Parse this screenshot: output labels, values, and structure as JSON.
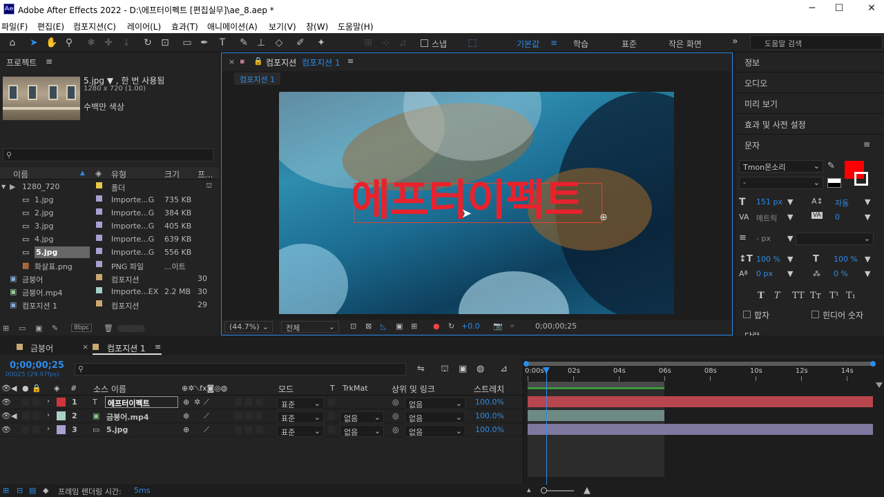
{
  "app_title": "Adobe After Effects 2022 - D:\\에프터이펙트 [편집실무]\\ae_8.aep *",
  "app_icon": "Ae",
  "window_controls": [
    "─",
    "☐",
    "✕"
  ],
  "menu": [
    "파일(F)",
    "편집(E)",
    "컴포지션(C)",
    "레이어(L)",
    "효과(T)",
    "애니메이션(A)",
    "보기(V)",
    "창(W)",
    "도움말(H)"
  ],
  "toolbar": {
    "snap_label": "스냅",
    "workspaces": [
      "기본값",
      "학습",
      "표준",
      "작은 화면"
    ],
    "active_workspace": "기본값",
    "more": "»",
    "search_placeholder": "도움말 검색"
  },
  "project": {
    "title": "프로젝트",
    "selected_name": "5.jpg ▼ , 한 번 사용됨",
    "selected_dims": "1280 x 720 (1.00)",
    "selected_color": "수백만 색상",
    "search_icon": "search-icon",
    "columns": [
      "이름",
      "유형",
      "크기",
      "프..."
    ],
    "items": [
      {
        "name": "1280_720",
        "type": "폴더",
        "size": "",
        "extra": "",
        "color": "#e6c94a",
        "indent": 0,
        "kind": "folder"
      },
      {
        "name": "1.jpg",
        "type": "Importe...G",
        "size": "735 KB",
        "extra": "",
        "color": "#a9a0d1",
        "indent": 1,
        "kind": "file"
      },
      {
        "name": "2.jpg",
        "type": "Importe...G",
        "size": "384 KB",
        "extra": "",
        "color": "#a9a0d1",
        "indent": 1,
        "kind": "file"
      },
      {
        "name": "3.jpg",
        "type": "Importe...G",
        "size": "405 KB",
        "extra": "",
        "color": "#a9a0d1",
        "indent": 1,
        "kind": "file"
      },
      {
        "name": "4.jpg",
        "type": "Importe...G",
        "size": "639 KB",
        "extra": "",
        "color": "#a9a0d1",
        "indent": 1,
        "kind": "file"
      },
      {
        "name": "5.jpg",
        "type": "Importe...G",
        "size": "556 KB",
        "extra": "",
        "color": "#a9a0d1",
        "indent": 1,
        "kind": "file",
        "selected": true
      },
      {
        "name": "화살표.png",
        "type": "PNG 파일",
        "size": "...이트",
        "extra": "",
        "color": "#a9a0d1",
        "indent": 1,
        "kind": "png"
      },
      {
        "name": "금붕어",
        "type": "컴포지션",
        "size": "",
        "extra": "30",
        "color": "#c9a871",
        "indent": 0,
        "kind": "comp"
      },
      {
        "name": "금붕어.mp4",
        "type": "Importe...EX",
        "size": "2.2 MB",
        "extra": "30",
        "color": "#a5d1c9",
        "indent": 0,
        "kind": "video"
      },
      {
        "name": "컴포지션 1",
        "type": "컴포지션",
        "size": "",
        "extra": "29",
        "color": "#c9a871",
        "indent": 0,
        "kind": "comp"
      }
    ],
    "footer_bpc": "8bpc"
  },
  "comp": {
    "panel_title": "컴포지션",
    "comp_name": "컴포지션 1",
    "breadcrumb": "컴포지션 1",
    "canvas_text": "에프터이펙트",
    "zoom": "(44.7%)",
    "resolution": "전체",
    "exposure": "+0.0",
    "timecode": "0;00;00;25"
  },
  "right_panel": {
    "items": [
      "정보",
      "오디오",
      "미리 보기",
      "효과 및 사전 설정"
    ],
    "character_title": "문자",
    "font_family": "Tmon몬소리",
    "font_style": "-",
    "font_size": "151 px",
    "leading": "자동",
    "kerning": "메트릭",
    "tracking": "0",
    "stroke_width": "- px",
    "vscale": "100 %",
    "hscale": "100 %",
    "baseline": "0 px",
    "tsume": "0 %",
    "style_buttons": [
      "T",
      "T",
      "TT",
      "Tт",
      "T¹",
      "T₁"
    ],
    "check_hapja": "합자",
    "check_hindi": "힌디어 숫자",
    "fill_color": "#ff0000",
    "cut_label": "단락"
  },
  "timeline": {
    "tabs": [
      "금붕어",
      "컴포지션 1"
    ],
    "active_tab": "컴포지션 1",
    "timecode": "0;00;00;25",
    "frames": "00025 (29.97fps)",
    "col_headers": {
      "num": "#",
      "source": "소스 이름",
      "mode": "모드",
      "t": "T",
      "trkmat": "TrkMat",
      "parent": "상위 및 링크",
      "stretch": "스트레치"
    },
    "ruler": [
      "0:00s",
      "02s",
      "04s",
      "06s",
      "08s",
      "10s",
      "12s",
      "14s"
    ],
    "layers": [
      {
        "num": "1",
        "name": "에프터이펙트",
        "mode": "표준",
        "trkmat": "",
        "parent": "없음",
        "stretch": "100.0%",
        "label": "#d0343b",
        "kind": "text",
        "bar": "#b8464e",
        "bar_end": 1.0
      },
      {
        "num": "2",
        "name": "금붕어.mp4",
        "mode": "표준",
        "trkmat": "없음",
        "parent": "없음",
        "stretch": "100.0%",
        "label": "#a5d1c9",
        "kind": "video",
        "bar": "#6e8a84",
        "bar_end": 0.396
      },
      {
        "num": "3",
        "name": "5.jpg",
        "mode": "표준",
        "trkmat": "없음",
        "parent": "없음",
        "stretch": "100.0%",
        "label": "#a9a0d1",
        "kind": "image",
        "bar": "#7e789f",
        "bar_end": 1.0
      }
    ],
    "playhead_fraction": 0.054,
    "work_area_end_fraction": 0.396
  },
  "status": {
    "label": "프레임 렌더링 시간:",
    "value": "5ms"
  }
}
